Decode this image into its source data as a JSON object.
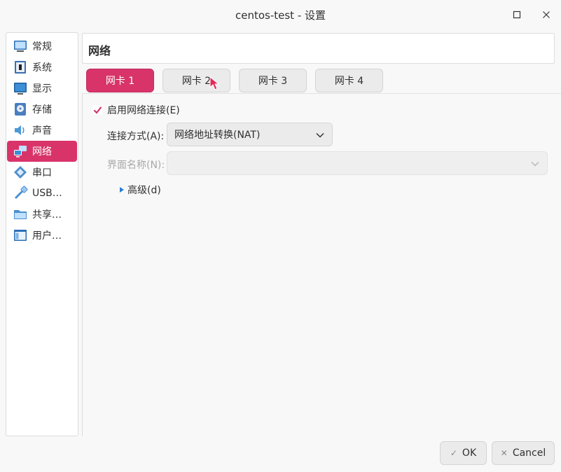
{
  "window": {
    "title": "centos-test - 设置"
  },
  "sidebar": {
    "items": [
      {
        "label": "常规",
        "icon": "monitor-icon"
      },
      {
        "label": "系统",
        "icon": "chip-icon"
      },
      {
        "label": "显示",
        "icon": "display-icon"
      },
      {
        "label": "存储",
        "icon": "disk-icon"
      },
      {
        "label": "声音",
        "icon": "speaker-icon"
      },
      {
        "label": "网络",
        "icon": "network-icon",
        "active": true
      },
      {
        "label": "串口",
        "icon": "serial-port-icon"
      },
      {
        "label": "USB…",
        "icon": "usb-icon"
      },
      {
        "label": "共享…",
        "icon": "folder-icon"
      },
      {
        "label": "用户…",
        "icon": "user-interface-icon"
      }
    ]
  },
  "section": {
    "title": "网络"
  },
  "tabs": [
    {
      "label": "网卡 1",
      "active": true
    },
    {
      "label": "网卡 2"
    },
    {
      "label": "网卡 3"
    },
    {
      "label": "网卡 4"
    }
  ],
  "adapter": {
    "enable_label": "启用网络连接(E)",
    "enabled": true,
    "attached_to_label": "连接方式(A):",
    "attached_to_value": "网络地址转换(NAT)",
    "name_label": "界面名称(N):",
    "name_value": "",
    "advanced_label": "高级(d)"
  },
  "buttons": {
    "ok": "OK",
    "cancel": "Cancel"
  },
  "colors": {
    "accent": "#d8346a"
  }
}
